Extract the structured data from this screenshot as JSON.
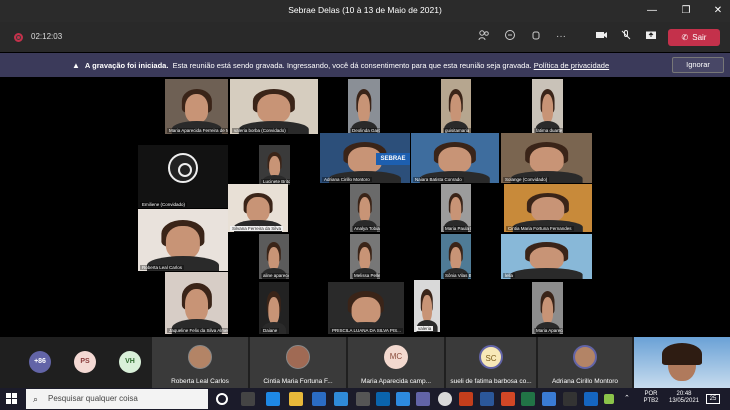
{
  "window": {
    "title": "Sebrae Delas (10 à 13 de Maio de 2021)",
    "minimize": "—",
    "restore": "❐",
    "close": "✕"
  },
  "toolbar": {
    "timer": "02:12:03",
    "leave_label": "Sair",
    "more": "···"
  },
  "banner": {
    "bold": "A gravação foi iniciada.",
    "text": "Esta reunião está sendo gravada. Ingressando, você dá consentimento para que esta reunião seja gravada.",
    "link": "Política de privacidade",
    "ignore": "Ignorar"
  },
  "grid": {
    "participants": [
      "Maria Aparecida Ferreira de Mo...",
      "valeria borba (Convidado)",
      "Deolinda Garcia",
      "guisitamaria",
      "fatima duarte",
      "Emiliene (Convidado)",
      "Lucinete Brito Vieira",
      "Adriana Cirillo Montoro",
      "Naiara Batista Conrado",
      "Solange (Convidado)",
      "Silvana Ferreira da Silva",
      "Analya Tobias",
      "Maria Paula Dias",
      "Cintia Maria Fortuna Fernandes",
      "Roberta Leal Carlos",
      "aline aparecida da silva",
      "Melissa Pellegrinet",
      "Sônia Vilas Boas",
      "lella",
      "Jaqueline Felix da Silva Almeida",
      "Daiane",
      "PRISCILA LUANA DA SILVA PIS...",
      "valeria",
      "Maria Aparecida campilo"
    ],
    "sebrae_logo": "SEBRAE"
  },
  "bottom": {
    "overflow": "+86",
    "ps": "PS",
    "vh": "VH",
    "tiles": [
      {
        "name": "Roberta Leal Carlos"
      },
      {
        "name": "Cintia Maria Fortuna F..."
      },
      {
        "name": "Maria Aparecida camp...",
        "initials": "MC"
      },
      {
        "name": "sueli de fatima barbosa co...",
        "initials": "SC"
      },
      {
        "name": "Adriana Cirillo Montoro"
      }
    ]
  },
  "taskbar": {
    "search_placeholder": "Pesquisar qualquer coisa",
    "lang1": "POR",
    "lang2": "PTB2",
    "time": "20:48",
    "date": "13/05/2021",
    "badge": "25"
  },
  "colors": {
    "leave": "#c4314b",
    "banner": "#3b3a5a",
    "ps": "#f4d9d4",
    "vh": "#d9f0d9",
    "mc": "#f3d9cf",
    "sc": "#f7e8b8",
    "overflow": "#6264a7"
  }
}
